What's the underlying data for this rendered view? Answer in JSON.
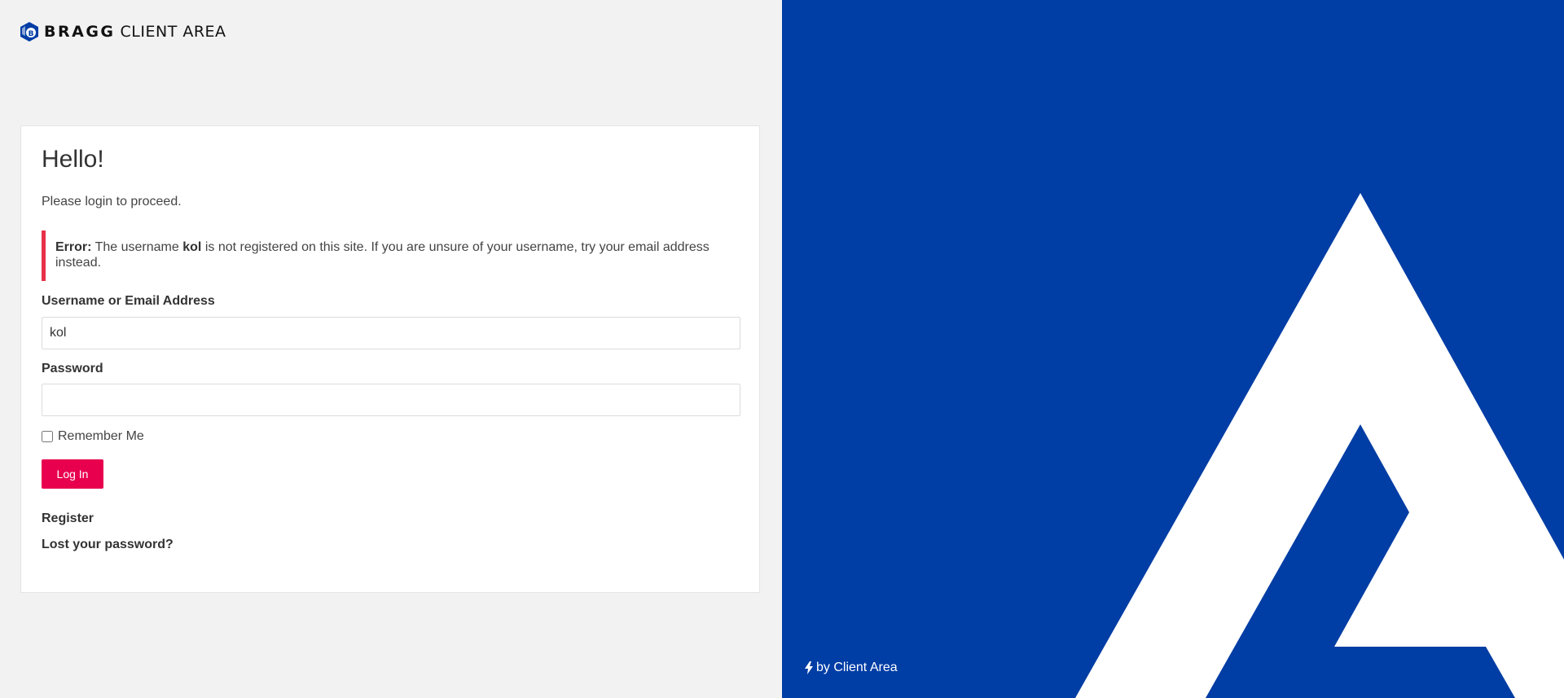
{
  "brand": {
    "name": "BRAGG",
    "suffix": "CLIENT AREA",
    "logo_icon": "bragg-diamond-logo-icon",
    "color": "#003da5"
  },
  "login": {
    "heading": "Hello!",
    "intro": "Please login to proceed.",
    "error": {
      "prefix": "Error:",
      "before_username": "The username",
      "username": "kol",
      "after_username": "is not registered on this site. If you are unsure of your username, try your email address instead.",
      "accent_color": "#e8304a"
    },
    "username_label": "Username or Email Address",
    "username_value": "kol",
    "password_label": "Password",
    "password_value": "",
    "remember_label": "Remember Me",
    "remember_checked": false,
    "submit_label": "Log In",
    "submit_color": "#e8004f",
    "register_link": "Register",
    "lost_password_link": "Lost your password?"
  },
  "side_panel": {
    "background": "#003da5",
    "mark": "white-a-logo-shape",
    "credit_icon": "lightning-bolt-icon",
    "credit_text": "by Client Area"
  }
}
